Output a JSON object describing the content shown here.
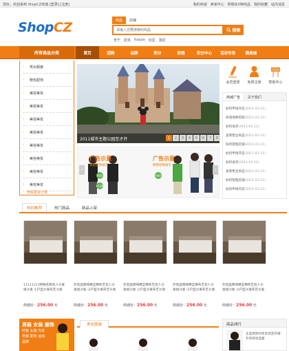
{
  "topbar": {
    "welcome": "您好，欢迎来到 ShopCZ商城 [登录] [注册]",
    "links": [
      "我的商城",
      "卖家中心",
      "购物车0种商品",
      "我的收藏",
      "站内消息"
    ]
  },
  "logo": {
    "part1": "Shop",
    "part2": "CZ"
  },
  "search": {
    "tabs": [
      "商品",
      "店铺"
    ],
    "placeholder": "请输入您要搜索的商品",
    "button": "搜索",
    "hot": [
      "李宁",
      "耐克",
      "Kappa",
      "双星",
      "骆驼"
    ]
  },
  "nav": {
    "category_label": "所有商品分类",
    "items": [
      "首页",
      "团购",
      "品牌",
      "积分",
      "促销",
      "积分中心",
      "活动专场",
      "微商城"
    ]
  },
  "categories": {
    "items": [
      "男女服装",
      "鞋包配饰",
      "美容美妆",
      "美容美妆",
      "美容美妆",
      "美容美妆",
      "美容美妆",
      "美容美妆",
      "美容美妆",
      "美容美妆"
    ],
    "all_link": "查看更多分类"
  },
  "slider": {
    "caption": "2011城市主题公园至才开",
    "pages": [
      "1",
      "2",
      "3",
      "4",
      "5",
      "6",
      "7",
      "8"
    ]
  },
  "ads": {
    "title": "广告示意",
    "subtitle": "网格轮换展示",
    "price1": "¥59",
    "price2": "¥139",
    "price3": "¥69"
  },
  "quick": {
    "items": [
      {
        "label": "会员登录",
        "icon": "pen-icon"
      },
      {
        "label": "免费注册",
        "icon": "user-icon"
      },
      {
        "label": "帮助中心",
        "icon": "help-icon"
      }
    ]
  },
  "news": {
    "tabs": [
      "商城广告",
      "关于我们"
    ],
    "rows": [
      {
        "title": "如何申请开店",
        "date": "(2011-01-11)"
      },
      {
        "title": "商城保障措施",
        "date": "(2011-01-11)"
      },
      {
        "title": "如何发货",
        "date": "(2011-01-11)"
      },
      {
        "title": "查看售出商品",
        "date": "(2011-01-11)"
      },
      {
        "title": "如何管理店铺",
        "date": "(2011-01-11)"
      },
      {
        "title": "如何申请开店",
        "date": "(2011-01-11)"
      },
      {
        "title": "如何发货",
        "date": "(2011-01-11)"
      },
      {
        "title": "查看售出商品",
        "date": "(2011-01-11)"
      },
      {
        "title": "如何管理店铺",
        "date": "(2011-01-11)"
      },
      {
        "title": "如何申请开店",
        "date": "(2011-01-11)"
      }
    ]
  },
  "products": {
    "tabs": [
      "特别推荐",
      "热门商品",
      "新品上架"
    ],
    "price_label": "商城价：",
    "currency": "元",
    "items": [
      {
        "name": "11111111特殊名称双人沙发组沙发 小户型沙发布艺沙发",
        "price": "256.00"
      },
      {
        "name": "外贸品牌纯棉全棉布艺双人沙发组沙发 小户型沙发布艺沙发",
        "price": "256.00"
      },
      {
        "name": "外贸品牌纯棉全棉布艺双人沙发组沙发 小户型沙发布艺沙发",
        "price": "256.00"
      },
      {
        "name": "外贸品牌纯棉全棉布艺双人沙发组沙发 小户型沙发布艺沙发",
        "price": "256.00"
      },
      {
        "name": "外贸品牌纯棉全棉布艺双人沙发组沙发 小户型沙发布艺沙发",
        "price": "256.00"
      }
    ]
  },
  "floor": {
    "banner_title": "男装 女装 服饰",
    "banner_links": "时装 女装 内衣 男装 配饰 运动 品牌",
    "tab": "男女服装"
  },
  "rank": {
    "title": "商品排行",
    "first": "正品新款时尚女装连衣裙 外贸修身显瘦"
  },
  "colors": {
    "accent": "#f07e14",
    "brand_blue": "#1e6fc9",
    "price": "#e4393c"
  }
}
